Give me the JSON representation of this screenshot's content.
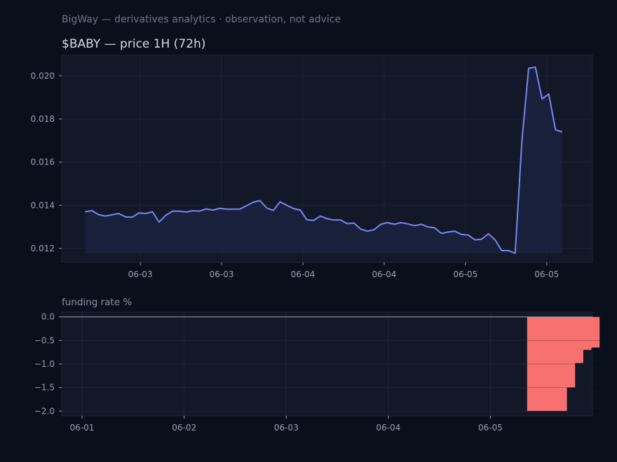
{
  "header": {
    "subtitle": "BigWay — derivatives analytics · observation, not advice"
  },
  "colors": {
    "background": "#0a0f1c",
    "plot_background": "#121828",
    "price_line": "#7b86f0",
    "price_fill": "#1a2240",
    "funding_bar": "#f87171",
    "zero_line": "#9aa1b5"
  },
  "chart_data": [
    {
      "type": "area",
      "title": "$BABY — price 1H (72h)",
      "xlabel": "",
      "ylabel": "",
      "ylim": [
        0.01135,
        0.02095
      ],
      "xlim": [
        -3.5,
        75.5
      ],
      "grid": true,
      "x_ticks": [
        {
          "x": 8.2,
          "label": "06-03"
        },
        {
          "x": 20.3,
          "label": "06-03"
        },
        {
          "x": 32.4,
          "label": "06-04"
        },
        {
          "x": 44.5,
          "label": "06-04"
        },
        {
          "x": 56.6,
          "label": "06-05"
        },
        {
          "x": 68.7,
          "label": "06-05"
        }
      ],
      "y_ticks": [
        0.012,
        0.014,
        0.016,
        0.018,
        0.02
      ],
      "y_tick_labels": [
        "0.012",
        "0.014",
        "0.016",
        "0.018",
        "0.020"
      ],
      "series": [
        {
          "values": [
            0.0137,
            0.01375,
            0.01357,
            0.0135,
            0.01356,
            0.01362,
            0.01346,
            0.01345,
            0.01365,
            0.01362,
            0.0137,
            0.01322,
            0.01354,
            0.01373,
            0.01373,
            0.01369,
            0.01375,
            0.01373,
            0.01383,
            0.01378,
            0.01386,
            0.01382,
            0.01382,
            0.01382,
            0.01398,
            0.01414,
            0.01422,
            0.01388,
            0.01376,
            0.01416,
            0.014,
            0.01385,
            0.01378,
            0.01333,
            0.0133,
            0.0135,
            0.01338,
            0.01332,
            0.01332,
            0.01315,
            0.01318,
            0.0129,
            0.0128,
            0.01287,
            0.01312,
            0.0132,
            0.01312,
            0.0132,
            0.01314,
            0.01306,
            0.01312,
            0.013,
            0.01296,
            0.0127,
            0.01276,
            0.0128,
            0.01265,
            0.01262,
            0.0124,
            0.01243,
            0.01268,
            0.0124,
            0.0119,
            0.0119,
            0.01178,
            0.017,
            0.02035,
            0.0204,
            0.01893,
            0.01915,
            0.0175,
            0.0174
          ]
        }
      ]
    },
    {
      "type": "bar",
      "title": "funding rate %",
      "xlabel": "",
      "ylabel": "",
      "ylim": [
        -2.1,
        0.1
      ],
      "xlim": [
        -0.2,
        5.0
      ],
      "grid": true,
      "x_ticks": [
        {
          "x": 0,
          "label": "06-01"
        },
        {
          "x": 1,
          "label": "06-02"
        },
        {
          "x": 2,
          "label": "06-03"
        },
        {
          "x": 3,
          "label": "06-04"
        },
        {
          "x": 4,
          "label": "06-05"
        }
      ],
      "y_ticks": [
        0.0,
        -0.5,
        -1.0,
        -1.5,
        -2.0
      ],
      "y_tick_labels": [
        "0.0",
        "−0.5",
        "−1.0",
        "−1.5",
        "−2.0"
      ],
      "series": [
        {
          "x": [
            4.38,
            4.46,
            4.54,
            4.62,
            4.7
          ],
          "values": [
            -2.0,
            -1.5,
            -0.98,
            -0.7,
            -0.65
          ],
          "bar_width": 0.39
        }
      ]
    }
  ]
}
